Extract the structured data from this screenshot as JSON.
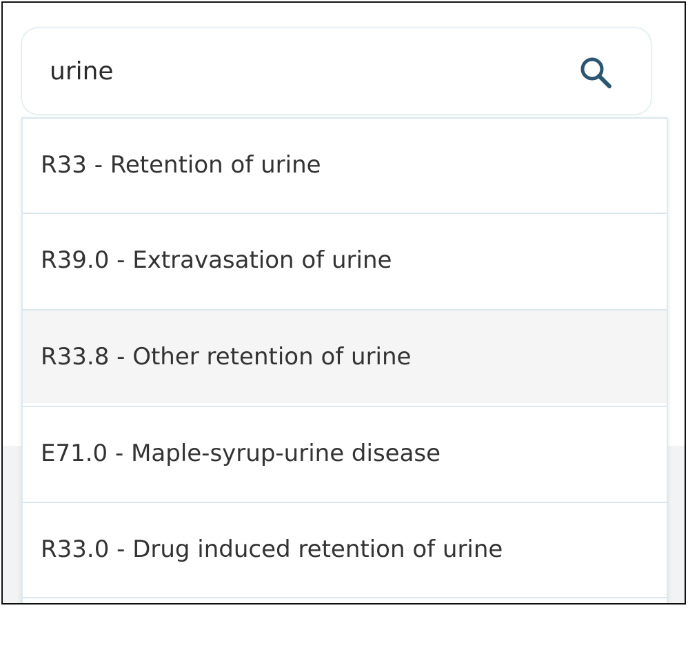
{
  "search": {
    "value": "urine",
    "icon": "search-icon",
    "icon_color": "#2b5570"
  },
  "results": {
    "items": [
      {
        "label": "R33 - Retention of urine"
      },
      {
        "label": "R39.0 - Extravasation of urine"
      },
      {
        "label": "R33.8 - Other retention of urine",
        "highlighted": true
      },
      {
        "label": "E71.0 - Maple-syrup-urine disease"
      },
      {
        "label": "R33.0 - Drug induced retention of urine"
      }
    ]
  },
  "colors": {
    "border": "#dbe7ec",
    "highlight_bg": "#f5f5f5",
    "text": "#333333"
  }
}
